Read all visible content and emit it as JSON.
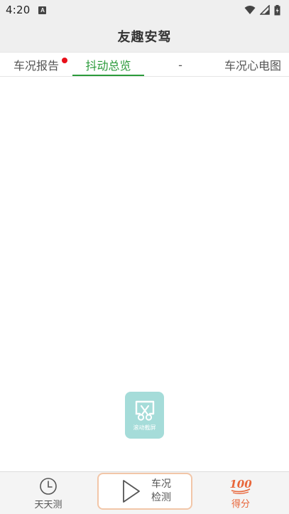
{
  "status": {
    "time": "4:20",
    "notif_letter": "A"
  },
  "header": {
    "title": "友趣安驾"
  },
  "tabs": [
    {
      "label": "车况报告",
      "has_badge": true
    },
    {
      "label": "抖动总览",
      "active": true
    },
    {
      "label": "-"
    },
    {
      "label": "车况心电图"
    }
  ],
  "floating_button": {
    "label": "滚动截屏"
  },
  "bottom_nav": {
    "left": {
      "label": "天天测",
      "icon": "clock-icon"
    },
    "center": {
      "line1": "车况",
      "line2": "检测",
      "icon": "play-icon"
    },
    "right": {
      "label": "得分",
      "icon": "hundred-points-icon",
      "icon_text": "100"
    }
  },
  "colors": {
    "accent": "#2a9a3a",
    "badge": "#e8101a",
    "score": "#e8663a",
    "floating_bg": "#a5dcd9",
    "center_border": "#f2c6a8"
  }
}
